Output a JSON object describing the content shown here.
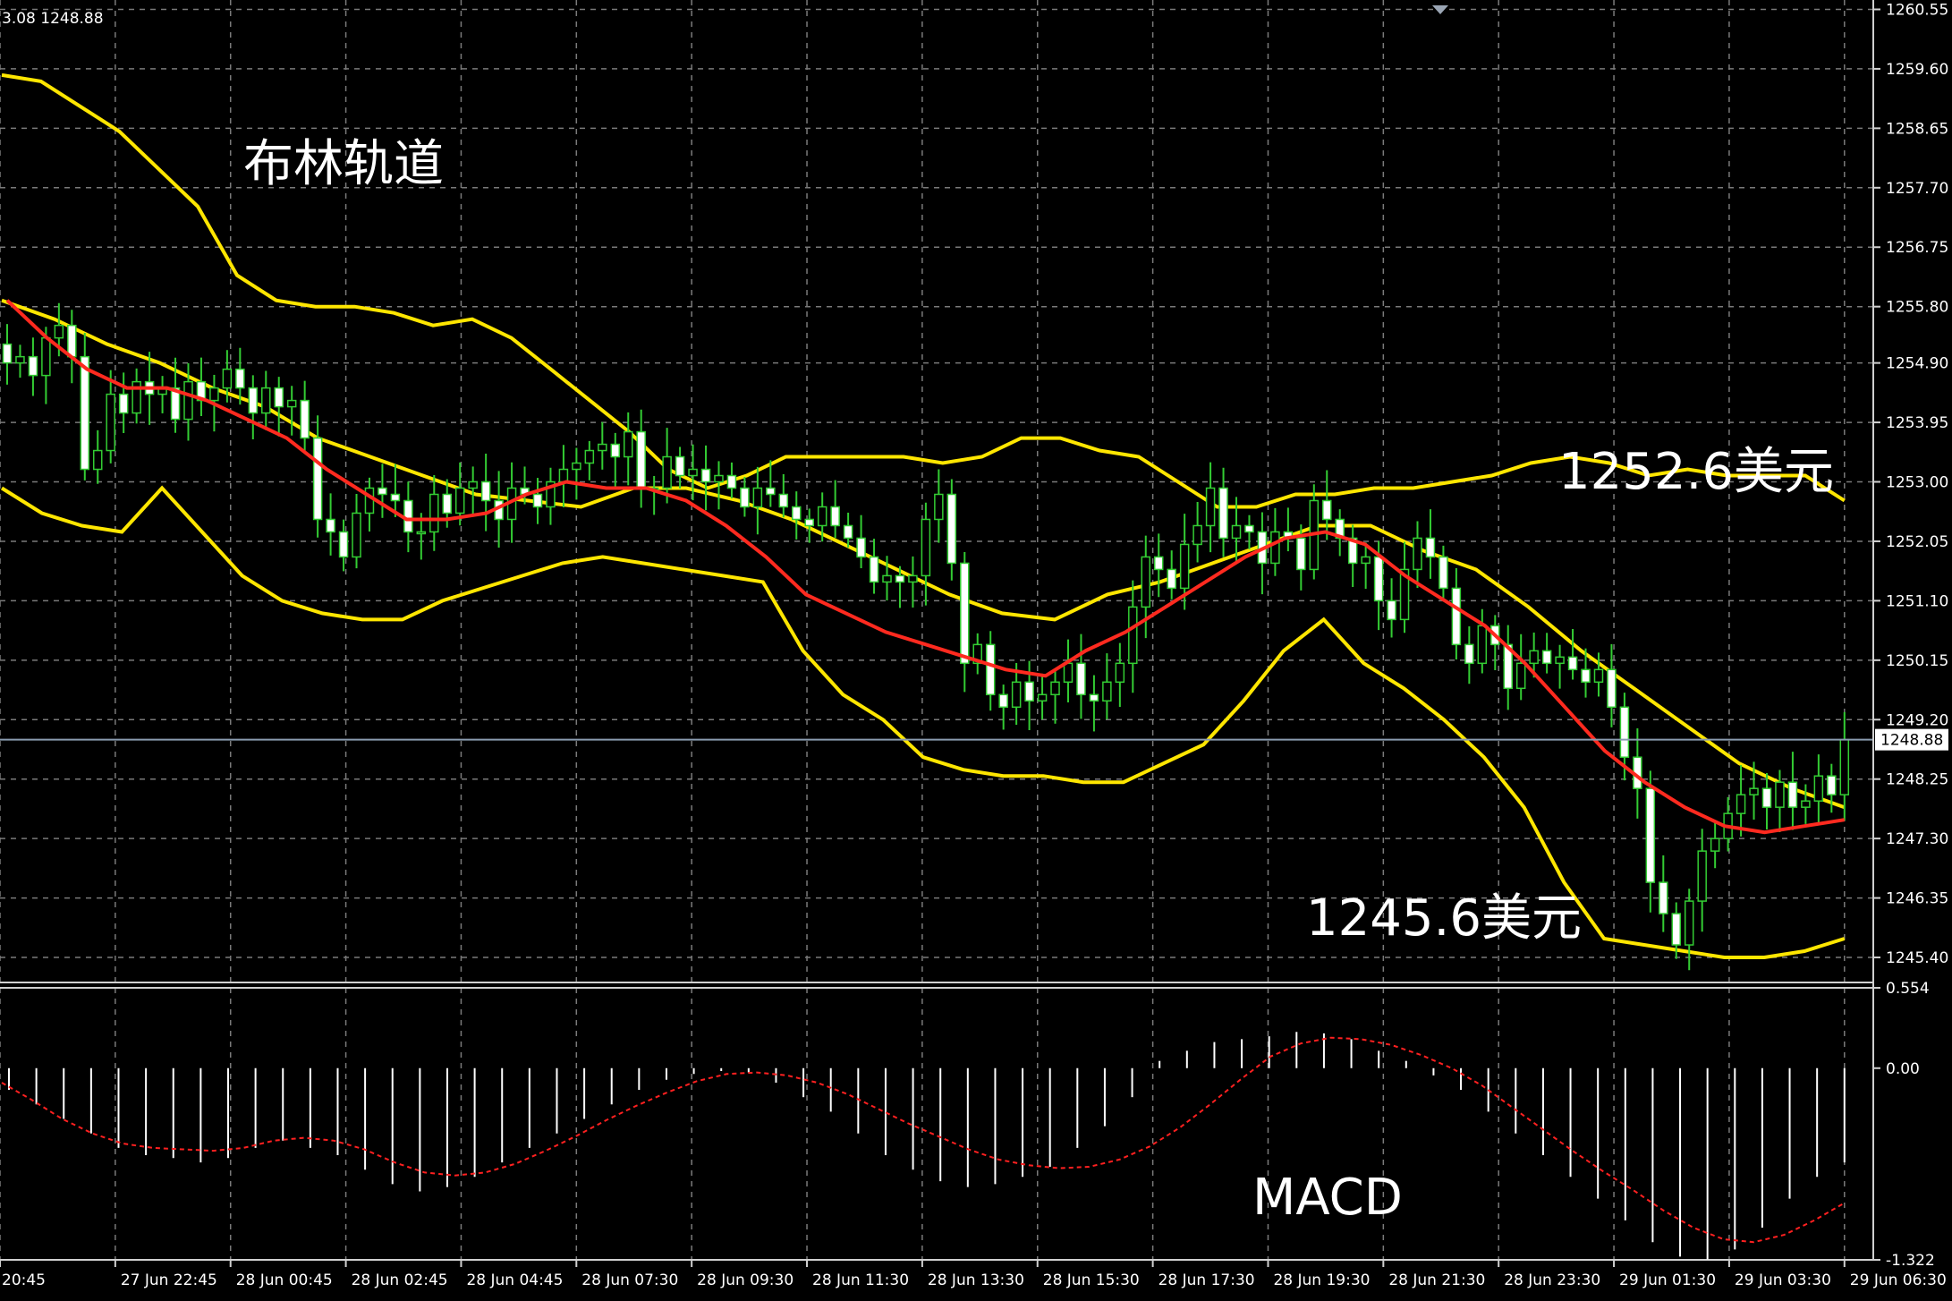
{
  "header": {
    "ohlc_text": "3.08 1248.88"
  },
  "annotations": {
    "bollinger": "布林轨道",
    "upper_price": "1252.6美元",
    "lower_price": "1245.6美元",
    "macd": "MACD"
  },
  "colors": {
    "background": "#000000",
    "grid": "#7a7a7a",
    "bollinger_bands": "#ffe600",
    "moving_average": "#ff2a1f",
    "candles": "#33cc33",
    "macd_histogram": "#ffffff",
    "macd_signal": "#ff2020",
    "current_price_line": "#8a9cb0"
  },
  "chart_data": [
    {
      "type": "candlestick",
      "title": "",
      "indicators": [
        "Bollinger Bands",
        "Moving Average"
      ],
      "ylim": [
        1245.0,
        1260.7
      ],
      "price_ticks": [
        "1260.55",
        "1259.60",
        "1258.65",
        "1257.70",
        "1256.75",
        "1255.80",
        "1254.90",
        "1253.95",
        "1253.00",
        "1252.05",
        "1251.10",
        "1250.15",
        "1249.20",
        "1248.25",
        "1247.30",
        "1246.35",
        "1245.40"
      ],
      "current_price": "1248.88",
      "time_ticks": [
        "20:45",
        "27 Jun 22:45",
        "28 Jun 00:45",
        "28 Jun 02:45",
        "28 Jun 04:45",
        "28 Jun 07:30",
        "28 Jun 09:30",
        "28 Jun 11:30",
        "28 Jun 13:30",
        "28 Jun 15:30",
        "28 Jun 17:30",
        "28 Jun 19:30",
        "28 Jun 21:30",
        "28 Jun 23:30",
        "29 Jun 01:30",
        "29 Jun 03:30",
        "29 Jun 06:30"
      ],
      "close": [
        1254.9,
        1255.0,
        1254.7,
        1255.3,
        1255.5,
        1255.0,
        1253.2,
        1253.5,
        1254.4,
        1254.1,
        1254.6,
        1254.4,
        1254.5,
        1254.0,
        1254.6,
        1254.3,
        1254.5,
        1254.8,
        1254.5,
        1254.1,
        1254.5,
        1254.2,
        1254.3,
        1253.7,
        1252.4,
        1252.2,
        1251.8,
        1252.5,
        1252.9,
        1252.8,
        1252.7,
        1252.2,
        1252.2,
        1252.8,
        1252.5,
        1252.9,
        1253.0,
        1252.7,
        1252.4,
        1252.9,
        1252.8,
        1252.6,
        1253.0,
        1253.2,
        1253.3,
        1253.5,
        1253.6,
        1253.4,
        1253.8,
        1252.9,
        1252.9,
        1253.4,
        1253.1,
        1253.2,
        1253.0,
        1253.1,
        1252.9,
        1252.6,
        1252.9,
        1252.8,
        1252.6,
        1252.4,
        1252.3,
        1252.6,
        1252.3,
        1252.1,
        1251.8,
        1251.4,
        1251.5,
        1251.4,
        1251.5,
        1252.4,
        1252.8,
        1251.7,
        1250.1,
        1250.4,
        1249.6,
        1249.4,
        1249.8,
        1249.5,
        1249.6,
        1249.8,
        1250.1,
        1249.6,
        1249.5,
        1249.8,
        1250.1,
        1251.0,
        1251.8,
        1251.6,
        1251.3,
        1252.0,
        1252.3,
        1252.9,
        1252.1,
        1252.3,
        1252.2,
        1251.7,
        1252.2,
        1252.1,
        1251.6,
        1252.7,
        1252.4,
        1252.1,
        1251.7,
        1251.8,
        1251.1,
        1250.8,
        1251.6,
        1252.1,
        1251.8,
        1251.3,
        1250.4,
        1250.1,
        1250.7,
        1250.4,
        1249.7,
        1250.1,
        1250.3,
        1250.1,
        1250.2,
        1250.0,
        1249.8,
        1250.0,
        1249.4,
        1248.6,
        1248.1,
        1246.6,
        1246.1,
        1245.6,
        1246.3,
        1247.1,
        1247.3,
        1247.7,
        1248.0,
        1248.1,
        1247.8,
        1248.2,
        1247.8,
        1247.9,
        1248.3,
        1248.0,
        1248.88
      ],
      "bollinger_upper": [
        1259.5,
        1259.4,
        1259.0,
        1258.6,
        1258.0,
        1257.4,
        1256.3,
        1255.9,
        1255.8,
        1255.8,
        1255.7,
        1255.5,
        1255.6,
        1255.3,
        1254.8,
        1254.3,
        1253.8,
        1253.2,
        1252.9,
        1253.1,
        1253.4,
        1253.4,
        1253.4,
        1253.4,
        1253.3,
        1253.4,
        1253.7,
        1253.7,
        1253.5,
        1253.4,
        1253.0,
        1252.6,
        1252.6,
        1252.8,
        1252.8,
        1252.9,
        1252.9,
        1253.0,
        1253.1,
        1253.3,
        1253.4,
        1253.3,
        1253.1,
        1253.2,
        1253.1,
        1253.1,
        1253.1,
        1252.7
      ],
      "bollinger_mid": [
        1255.9,
        1255.6,
        1255.2,
        1254.9,
        1254.5,
        1254.2,
        1253.7,
        1253.4,
        1253.1,
        1252.8,
        1252.7,
        1252.6,
        1252.9,
        1252.9,
        1252.7,
        1252.4,
        1252.0,
        1251.6,
        1251.2,
        1250.9,
        1250.8,
        1251.2,
        1251.4,
        1251.7,
        1252.0,
        1252.3,
        1252.3,
        1251.9,
        1251.6,
        1251.0,
        1250.3,
        1249.7,
        1249.1,
        1248.5,
        1248.1,
        1247.8
      ],
      "bollinger_lower": [
        1252.9,
        1252.5,
        1252.3,
        1252.2,
        1252.9,
        1252.2,
        1251.5,
        1251.1,
        1250.9,
        1250.8,
        1250.8,
        1251.1,
        1251.3,
        1251.5,
        1251.7,
        1251.8,
        1251.7,
        1251.6,
        1251.5,
        1251.4,
        1250.3,
        1249.6,
        1249.2,
        1248.6,
        1248.4,
        1248.3,
        1248.3,
        1248.2,
        1248.2,
        1248.5,
        1248.8,
        1249.5,
        1250.3,
        1250.8,
        1250.1,
        1249.7,
        1249.2,
        1248.6,
        1247.8,
        1246.6,
        1245.7,
        1245.6,
        1245.5,
        1245.4,
        1245.4,
        1245.5,
        1245.7
      ],
      "moving_average": [
        1255.9,
        1255.3,
        1254.8,
        1254.5,
        1254.5,
        1254.3,
        1254.0,
        1253.7,
        1253.2,
        1252.8,
        1252.4,
        1252.4,
        1252.5,
        1252.8,
        1253.0,
        1252.9,
        1252.9,
        1252.7,
        1252.3,
        1251.8,
        1251.2,
        1250.9,
        1250.6,
        1250.4,
        1250.2,
        1250.0,
        1249.9,
        1250.3,
        1250.6,
        1251.0,
        1251.4,
        1251.8,
        1252.1,
        1252.2,
        1252.0,
        1251.5,
        1251.1,
        1250.7,
        1250.1,
        1249.4,
        1248.7,
        1248.2,
        1247.8,
        1247.5,
        1247.4,
        1247.5,
        1247.6
      ]
    },
    {
      "type": "bar",
      "title": "MACD",
      "ylim": [
        -1.322,
        0.554
      ],
      "y_ticks": [
        "0.554",
        "0.00",
        "-1.322"
      ],
      "histogram": [
        -0.15,
        -0.25,
        -0.35,
        -0.45,
        -0.55,
        -0.6,
        -0.62,
        -0.65,
        -0.62,
        -0.55,
        -0.5,
        -0.55,
        -0.6,
        -0.7,
        -0.8,
        -0.85,
        -0.82,
        -0.75,
        -0.65,
        -0.55,
        -0.45,
        -0.35,
        -0.25,
        -0.15,
        -0.08,
        -0.04,
        -0.02,
        -0.03,
        -0.1,
        -0.2,
        -0.3,
        -0.45,
        -0.6,
        -0.7,
        -0.78,
        -0.82,
        -0.8,
        -0.75,
        -0.68,
        -0.55,
        -0.4,
        -0.2,
        0.05,
        0.12,
        0.18,
        0.2,
        0.22,
        0.25,
        0.24,
        0.2,
        0.12,
        0.05,
        -0.05,
        -0.15,
        -0.3,
        -0.45,
        -0.6,
        -0.75,
        -0.9,
        -1.05,
        -1.2,
        -1.3,
        -1.32,
        -1.25,
        -1.1,
        -0.9,
        -0.75,
        -0.65
      ],
      "signal": [
        -0.1,
        -0.22,
        -0.35,
        -0.45,
        -0.52,
        -0.55,
        -0.56,
        -0.57,
        -0.55,
        -0.5,
        -0.48,
        -0.5,
        -0.56,
        -0.65,
        -0.72,
        -0.74,
        -0.72,
        -0.66,
        -0.57,
        -0.47,
        -0.36,
        -0.26,
        -0.17,
        -0.09,
        -0.04,
        -0.03,
        -0.05,
        -0.1,
        -0.18,
        -0.28,
        -0.38,
        -0.47,
        -0.56,
        -0.63,
        -0.67,
        -0.69,
        -0.68,
        -0.63,
        -0.54,
        -0.41,
        -0.25,
        -0.08,
        0.08,
        0.17,
        0.21,
        0.2,
        0.16,
        0.09,
        0.0,
        -0.12,
        -0.27,
        -0.42,
        -0.57,
        -0.71,
        -0.84,
        -0.98,
        -1.1,
        -1.18,
        -1.2,
        -1.15,
        -1.05,
        -0.93
      ]
    }
  ]
}
